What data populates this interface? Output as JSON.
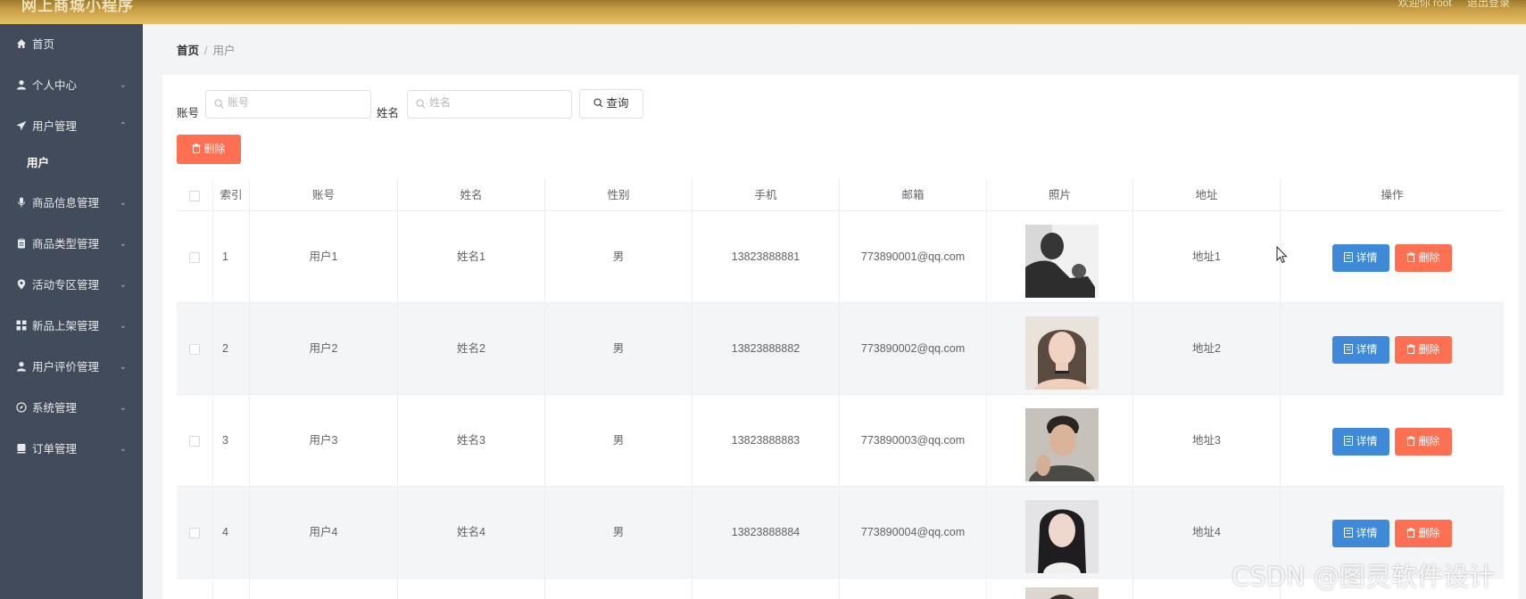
{
  "header": {
    "brand": "网上商城小程序",
    "links": [
      "欢迎你 root",
      "退出登录"
    ]
  },
  "sidebar": {
    "items": [
      {
        "label": "首页",
        "icon": "home-icon",
        "expandable": false
      },
      {
        "label": "个人中心",
        "icon": "user-icon",
        "expandable": true
      },
      {
        "label": "用户管理",
        "icon": "send-icon",
        "expandable": true,
        "expanded": true,
        "children": [
          "用户"
        ]
      },
      {
        "label": "商品信息管理",
        "icon": "mic-icon",
        "expandable": true
      },
      {
        "label": "商品类型管理",
        "icon": "clipboard-icon",
        "expandable": true
      },
      {
        "label": "活动专区管理",
        "icon": "location-icon",
        "expandable": true
      },
      {
        "label": "新品上架管理",
        "icon": "grid-icon",
        "expandable": true
      },
      {
        "label": "用户评价管理",
        "icon": "user-icon",
        "expandable": true
      },
      {
        "label": "系统管理",
        "icon": "compass-icon",
        "expandable": true
      },
      {
        "label": "订单管理",
        "icon": "document-icon",
        "expandable": true
      }
    ]
  },
  "breadcrumb": {
    "home": "首页",
    "separator": "/",
    "current": "用户"
  },
  "search": {
    "account_label": "账号",
    "account_placeholder": "账号",
    "name_label": "姓名",
    "name_placeholder": "姓名",
    "query_button": "查询"
  },
  "toolbar": {
    "delete_label": "删除"
  },
  "table": {
    "columns": [
      "索引",
      "账号",
      "姓名",
      "性别",
      "手机",
      "邮箱",
      "照片",
      "地址",
      "操作"
    ],
    "rows": [
      {
        "index": "1",
        "account": "用户1",
        "name": "姓名1",
        "gender": "男",
        "phone": "13823888881",
        "email": "773890001@qq.com",
        "address": "地址1"
      },
      {
        "index": "2",
        "account": "用户2",
        "name": "姓名2",
        "gender": "男",
        "phone": "13823888882",
        "email": "773890002@qq.com",
        "address": "地址2"
      },
      {
        "index": "3",
        "account": "用户3",
        "name": "姓名3",
        "gender": "男",
        "phone": "13823888883",
        "email": "773890003@qq.com",
        "address": "地址3"
      },
      {
        "index": "4",
        "account": "用户4",
        "name": "姓名4",
        "gender": "男",
        "phone": "13823888884",
        "email": "773890004@qq.com",
        "address": "地址4"
      }
    ],
    "detail_label": "详情",
    "row_delete_label": "删除"
  },
  "watermark": "CSDN @图灵软件设计",
  "colors": {
    "sidebar": "#424b5c",
    "primary": "#3f8ad8",
    "danger": "#ff6f52",
    "header_gold": "#c79d45"
  }
}
